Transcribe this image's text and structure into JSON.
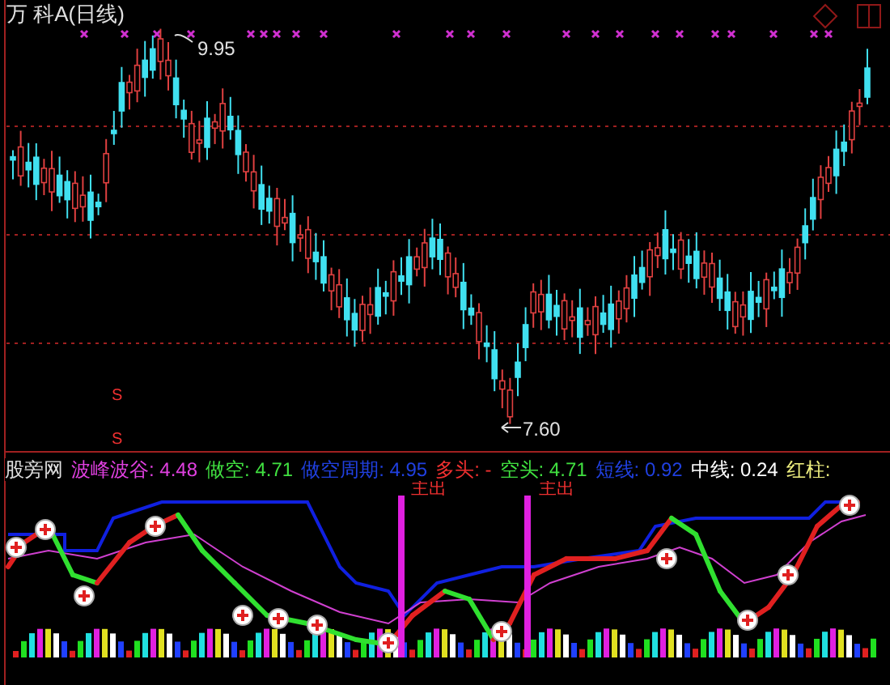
{
  "chart_title": "万 科A(日线)",
  "price_panel": {
    "high_label": "9.95",
    "low_label": "7.60",
    "sell_markers": [
      "S",
      "S"
    ]
  },
  "indicator_legend": [
    {
      "text": "股旁网",
      "color": "#e0e0e0"
    },
    {
      "text": "波峰波谷: 4.48",
      "color": "#e040e0"
    },
    {
      "text": "做空: 4.71",
      "color": "#40e040"
    },
    {
      "text": "做空周期: 4.95",
      "color": "#2040e0"
    },
    {
      "text": "多头: -",
      "color": "#f03030"
    },
    {
      "text": "空头: 4.71",
      "color": "#40e040"
    },
    {
      "text": "短线: 0.92",
      "color": "#2040e0"
    },
    {
      "text": "中线: 0.24",
      "color": "#ffffff"
    },
    {
      "text": "红柱:",
      "color": "#f0f080"
    }
  ],
  "signal_labels": [
    "主出",
    "主出"
  ]
}
